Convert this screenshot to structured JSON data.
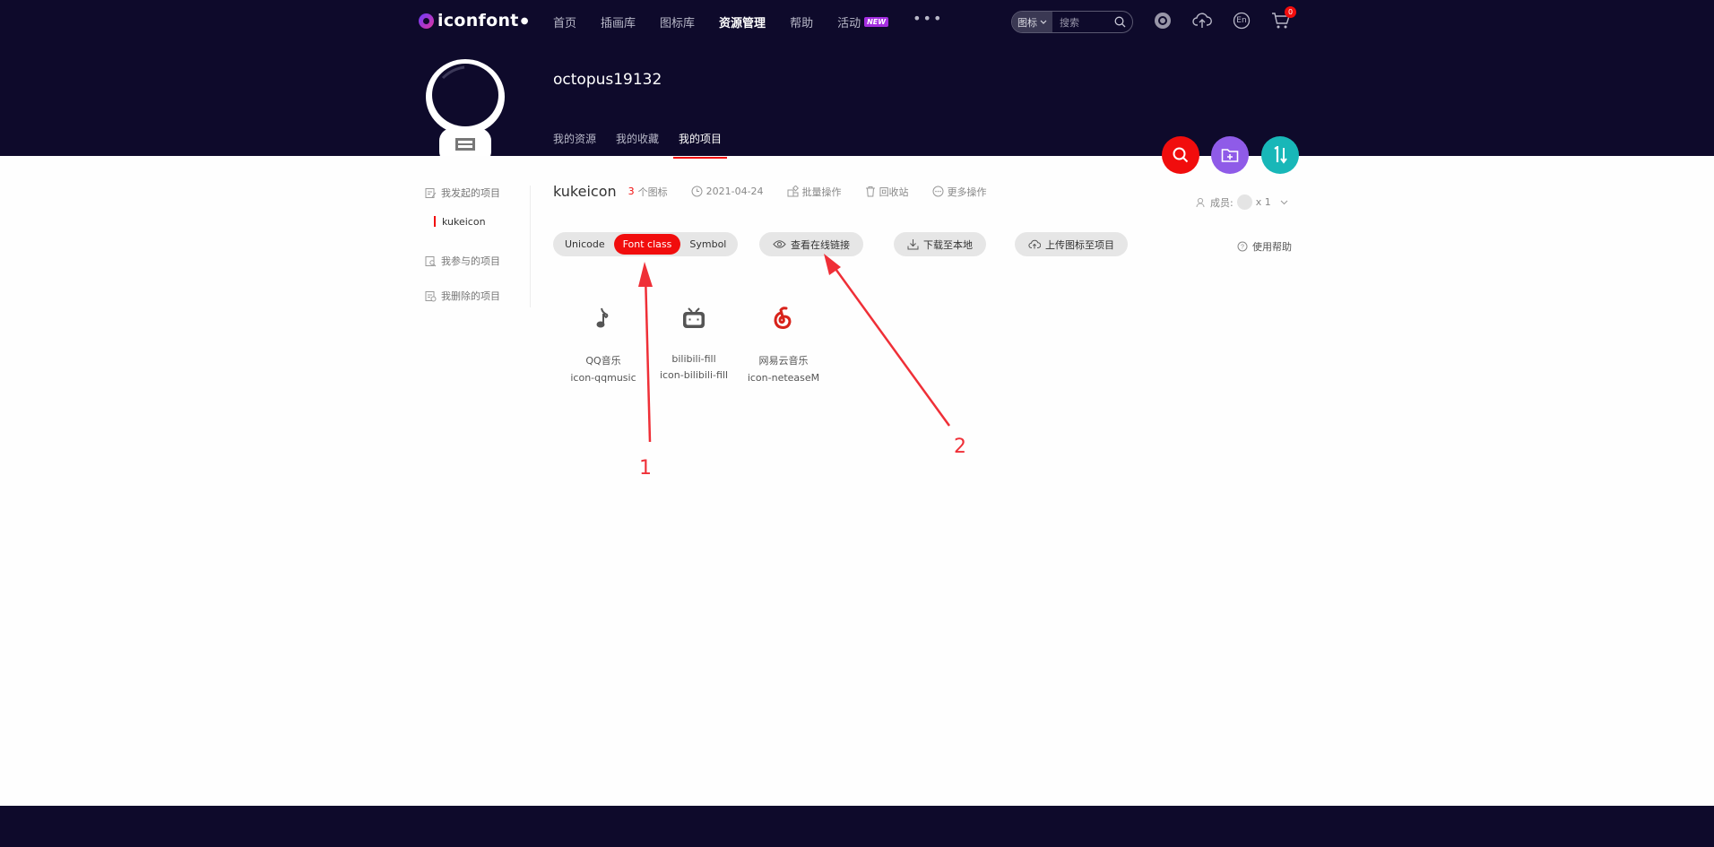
{
  "header": {
    "logo_text": "iconfont",
    "nav": [
      {
        "label": "首页"
      },
      {
        "label": "插画库"
      },
      {
        "label": "图标库"
      },
      {
        "label": "资源管理"
      },
      {
        "label": "帮助"
      },
      {
        "label": "活动",
        "badge": "NEW"
      }
    ],
    "search": {
      "type_label": "图标",
      "placeholder": "搜索"
    },
    "cart_count": "0",
    "lang_label": "En"
  },
  "profile": {
    "username": "octopus19132",
    "tabs": [
      {
        "label": "我的资源"
      },
      {
        "label": "我的收藏"
      },
      {
        "label": "我的项目"
      }
    ]
  },
  "sidebar": {
    "items": [
      {
        "label": "我发起的项目"
      },
      {
        "label": "kukeicon"
      },
      {
        "label": "我参与的项目"
      },
      {
        "label": "我删除的项目"
      }
    ]
  },
  "project": {
    "title": "kukeicon",
    "icon_count": "3",
    "icon_count_label": "个图标",
    "date": "2021-04-24",
    "batch_label": "批量操作",
    "trash_label": "回收站",
    "more_label": "更多操作",
    "members_label": "成员:",
    "members_count": "x 1"
  },
  "toolbar": {
    "segments": [
      {
        "label": "Unicode",
        "active": false
      },
      {
        "label": "Font class",
        "active": true
      },
      {
        "label": "Symbol",
        "active": false
      }
    ],
    "view_link_label": "查看在线链接",
    "download_label": "下载至本地",
    "upload_label": "上传图标至项目",
    "help_label": "使用帮助"
  },
  "icons": [
    {
      "name": "QQ音乐",
      "class": "icon-qqmusic",
      "glyph": "music-note-icon"
    },
    {
      "name": "bilibili-fill",
      "class": "icon-bilibili-fill",
      "glyph": "bilibili-icon"
    },
    {
      "name": "网易云音乐",
      "class": "icon-neteaseM",
      "glyph": "netease-music-icon"
    }
  ],
  "annotations": [
    {
      "label": "1"
    },
    {
      "label": "2"
    }
  ],
  "colors": {
    "header_bg": "#0e0a2b",
    "accent_red": "#f10d0d",
    "fab_purple": "#8f5be8",
    "fab_teal": "#18b7b8",
    "annotation": "#ef2f37"
  }
}
